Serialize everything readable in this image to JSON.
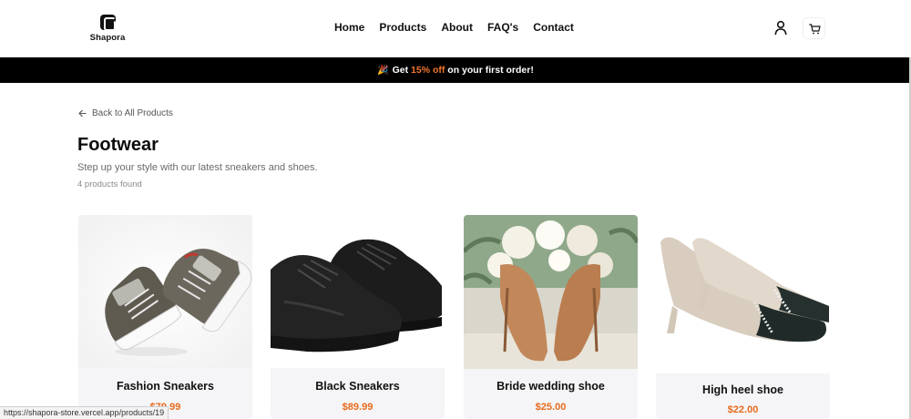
{
  "header": {
    "logo_text": "Shapora",
    "nav": [
      "Home",
      "Products",
      "About",
      "FAQ's",
      "Contact"
    ]
  },
  "promo": {
    "prefix": "Get ",
    "highlight": "15% off",
    "suffix": " on your first order!",
    "accent_color": "#f2762e"
  },
  "page": {
    "back_link": "Back to All Products",
    "title": "Footwear",
    "subtitle": "Step up your style with our latest sneakers and shoes.",
    "count": "4 products found"
  },
  "products": [
    {
      "name": "Fashion Sneakers",
      "price": "$79.99"
    },
    {
      "name": "Black Sneakers",
      "price": "$89.99"
    },
    {
      "name": "Bride wedding shoe",
      "price": "$25.00"
    },
    {
      "name": "High heel shoe",
      "price": "$22.00"
    }
  ],
  "status": {
    "url": "https://shapora-store.vercel.app/products/19"
  }
}
